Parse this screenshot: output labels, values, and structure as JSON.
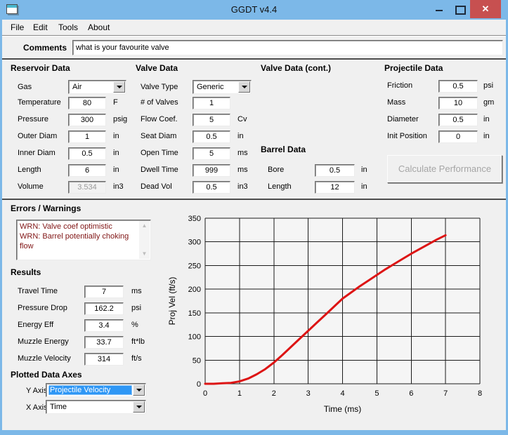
{
  "window": {
    "title": "GGDT v4.4"
  },
  "menu": {
    "items": [
      {
        "label": "File"
      },
      {
        "label": "Edit"
      },
      {
        "label": "Tools"
      },
      {
        "label": "About"
      }
    ]
  },
  "comments": {
    "label": "Comments",
    "value": "what is your favourite valve"
  },
  "sections": {
    "reservoir": {
      "header": "Reservoir Data",
      "gas": {
        "label": "Gas",
        "value": "Air"
      },
      "fields": [
        {
          "label": "Temperature",
          "value": "80",
          "unit": "F"
        },
        {
          "label": "Pressure",
          "value": "300",
          "unit": "psig"
        },
        {
          "label": "Outer Diam",
          "value": "1",
          "unit": "in"
        },
        {
          "label": "Inner Diam",
          "value": "0.5",
          "unit": "in"
        },
        {
          "label": "Length",
          "value": "6",
          "unit": "in"
        },
        {
          "label": "Volume",
          "value": "3.534",
          "unit": "in3"
        }
      ]
    },
    "valve": {
      "header": "Valve Data",
      "valve_type": {
        "label": "Valve Type",
        "value": "Generic"
      },
      "fields": [
        {
          "label": "# of Valves",
          "value": "1",
          "unit": ""
        },
        {
          "label": "Flow Coef.",
          "value": "5",
          "unit": "Cv"
        },
        {
          "label": "Seat Diam",
          "value": "0.5",
          "unit": "in"
        },
        {
          "label": "Open Time",
          "value": "5",
          "unit": "ms"
        },
        {
          "label": "Dwell Time",
          "value": "999",
          "unit": "ms"
        },
        {
          "label": "Dead Vol",
          "value": "0.5",
          "unit": "in3"
        }
      ]
    },
    "valve_cont": {
      "header": "Valve Data (cont.)"
    },
    "barrel": {
      "header": "Barrel Data",
      "fields": [
        {
          "label": "Bore",
          "value": "0.5",
          "unit": "in"
        },
        {
          "label": "Length",
          "value": "12",
          "unit": "in"
        }
      ]
    },
    "projectile": {
      "header": "Projectile Data",
      "fields": [
        {
          "label": "Friction",
          "value": "0.5",
          "unit": "psi"
        },
        {
          "label": "Mass",
          "value": "10",
          "unit": "gm"
        },
        {
          "label": "Diameter",
          "value": "0.5",
          "unit": "in"
        },
        {
          "label": "Init Position",
          "value": "0",
          "unit": "in"
        }
      ],
      "button": "Calculate Performance"
    }
  },
  "errors": {
    "header": "Errors / Warnings",
    "messages": "WRN: Valve coef optimistic WRN: Barrel potentially choking flow",
    "line1": "WRN: Valve coef optimistic",
    "line2": "WRN: Barrel potentially choking flow",
    "text_color": "#801515"
  },
  "results": {
    "header": "Results",
    "fields": [
      {
        "label": "Travel Time",
        "value": "7",
        "unit": "ms"
      },
      {
        "label": "Pressure Drop",
        "value": "162.2",
        "unit": "psi"
      },
      {
        "label": "Energy Eff",
        "value": "3.4",
        "unit": "%"
      },
      {
        "label": "Muzzle Energy",
        "value": "33.7",
        "unit": "ft*lb"
      },
      {
        "label": "Muzzle Velocity",
        "value": "314",
        "unit": "ft/s"
      }
    ]
  },
  "axes": {
    "header": "Plotted Data Axes",
    "y": {
      "label": "Y Axis",
      "value": "Projectile Velocity"
    },
    "x": {
      "label": "X Axis",
      "value": "Time"
    }
  },
  "chart_data": {
    "type": "line",
    "title": "",
    "xlabel": "Time (ms)",
    "ylabel": "Proj Vel (ft/s)",
    "xlim": [
      0,
      8
    ],
    "ylim": [
      0,
      350
    ],
    "xticks": [
      0,
      1,
      2,
      3,
      4,
      5,
      6,
      7,
      8
    ],
    "yticks": [
      0,
      50,
      100,
      150,
      200,
      250,
      300,
      350
    ],
    "grid": true,
    "legend": "none",
    "line_color": "#dd1414",
    "plot_bg": "#f5f5f5",
    "series": [
      {
        "name": "Projectile Velocity",
        "x": [
          0,
          0.25,
          0.5,
          0.75,
          1,
          1.25,
          1.5,
          1.75,
          2,
          2.25,
          2.5,
          2.75,
          3,
          3.25,
          3.5,
          3.75,
          4,
          4.25,
          4.5,
          4.75,
          5,
          5.25,
          5.5,
          5.75,
          6,
          6.25,
          6.5,
          6.75,
          7
        ],
        "y": [
          0,
          0,
          1,
          2,
          5,
          11,
          20,
          31,
          45,
          61,
          78,
          95,
          112,
          129,
          146,
          163,
          180,
          193,
          206,
          218,
          230,
          242,
          253,
          264,
          275,
          285,
          295,
          305,
          314
        ]
      }
    ]
  }
}
